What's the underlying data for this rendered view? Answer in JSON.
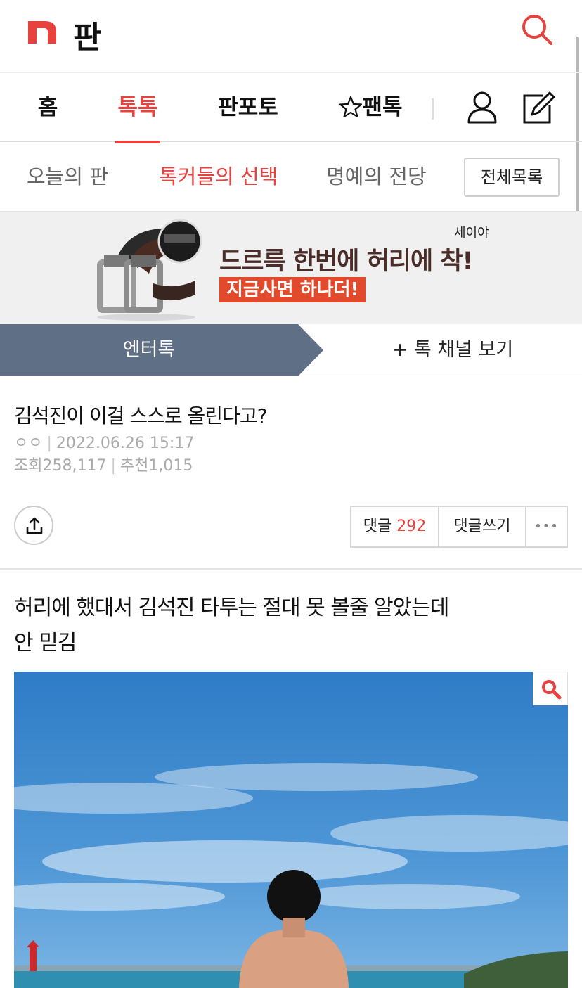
{
  "header": {
    "logo_letter": "n",
    "logo_text": "판",
    "search_icon": "search-icon"
  },
  "nav": {
    "items": [
      {
        "label": "홈"
      },
      {
        "label": "톡톡"
      },
      {
        "label": "판포토"
      },
      {
        "label": "팬톡",
        "icon": "star-outline-icon"
      }
    ],
    "active": "톡톡",
    "user_icon": "user-icon",
    "write_icon": "edit-icon"
  },
  "subnav": {
    "items": [
      {
        "label": "오늘의 판"
      },
      {
        "label": "톡커들의 선택"
      },
      {
        "label": "명예의 전당"
      }
    ],
    "active": "톡커들의 선택",
    "all_button": "전체목록"
  },
  "ad": {
    "brand": "세이야",
    "headline": "드르륵 한번에 허리에 착!",
    "cta": "지금사면 하나더!"
  },
  "channel": {
    "label": "엔터톡",
    "more_label": "+ 톡 채널 보기"
  },
  "post": {
    "title": "김석진이 이걸 스스로 올린다고?",
    "author": "ㅇㅇ",
    "date": "2022.06.26 15:17",
    "views_label": "조회",
    "views": "258,117",
    "recommend_label": "추천",
    "recommend": "1,015",
    "comment_label": "댓글",
    "comment_count": "292",
    "write_comment_label": "댓글쓰기",
    "more_label": "•••",
    "body_line1": "허리에 했대서 김석진 타투는 절대 못 볼줄 알았는데",
    "body_line2": "안 믿김"
  },
  "colors": {
    "accent": "#e8423f",
    "channel_bg": "#5f6f86",
    "ad_cta": "#e34a2b",
    "sky": "#3f86c9"
  }
}
